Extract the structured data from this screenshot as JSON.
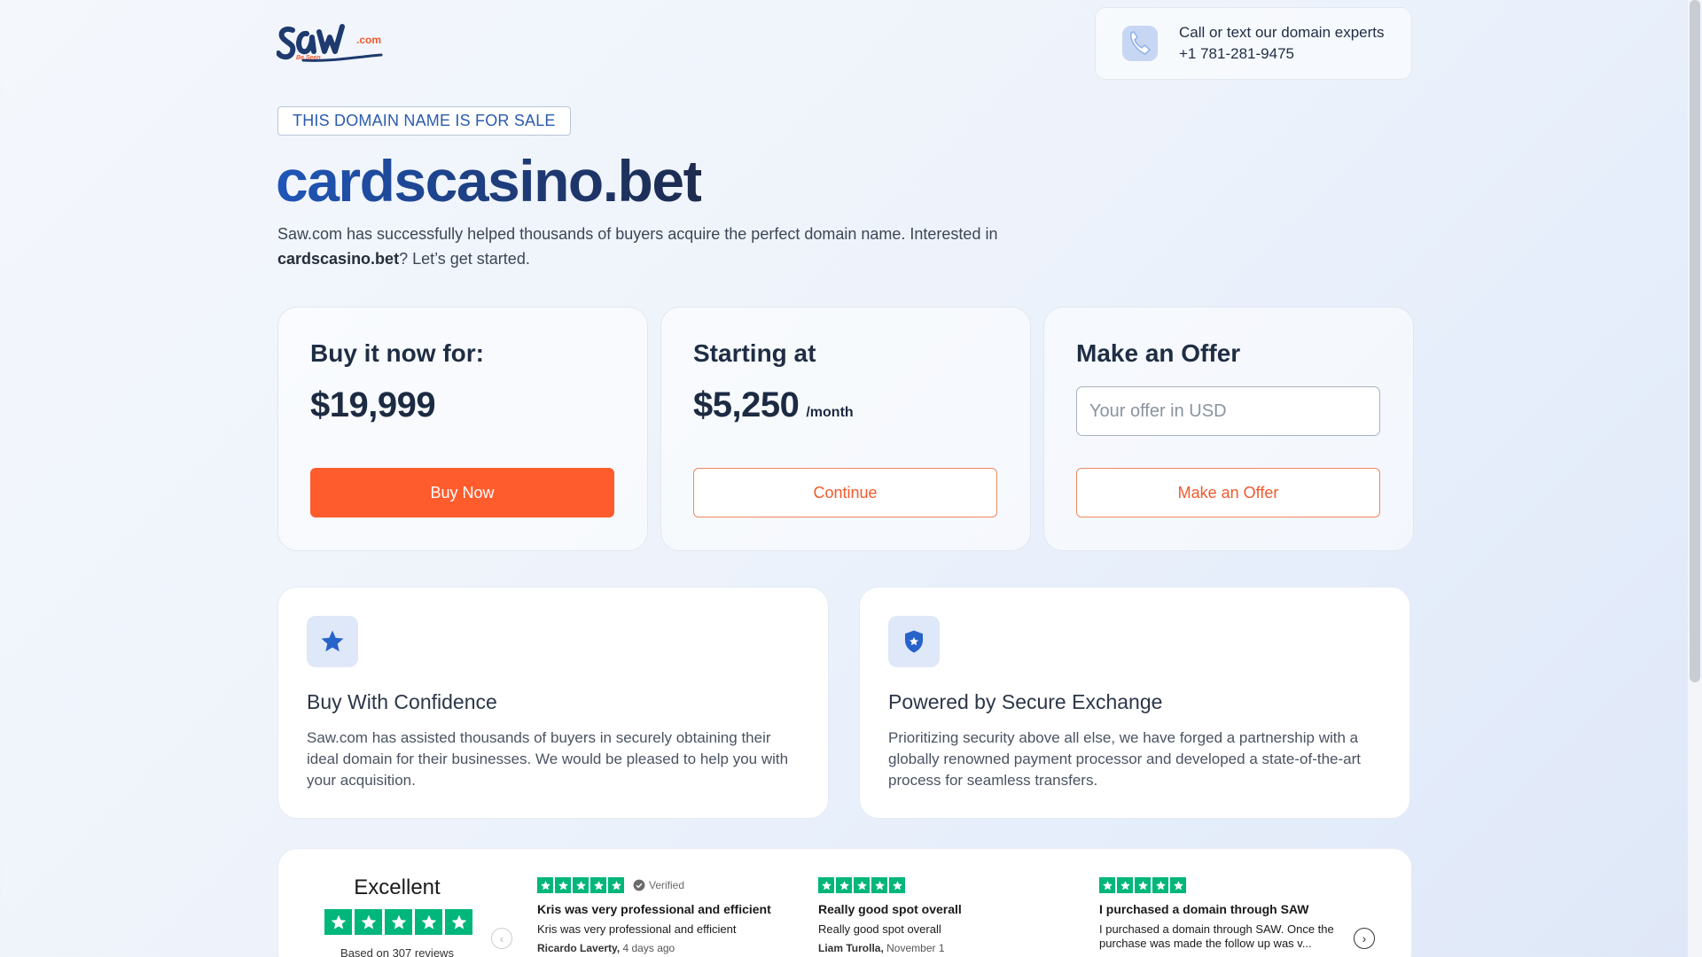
{
  "header": {
    "logo_text": "saw.com",
    "logo_tagline": "Be Seen",
    "contact_line1": "Call or text our domain experts",
    "contact_phone": "+1 781-281-9475"
  },
  "hero": {
    "badge": "THIS DOMAIN NAME IS FOR SALE",
    "domain": "cardscasino.bet",
    "intro_part1": "Saw.com has successfully helped thousands of buyers acquire the perfect domain name. Interested in ",
    "intro_domain": "cardscasino.bet",
    "intro_part2": "? Let’s get started."
  },
  "pricing": {
    "buy": {
      "title": "Buy it now for:",
      "price": "$19,999",
      "button": "Buy Now"
    },
    "lease": {
      "title": "Starting at",
      "price": "$5,250",
      "period": "/month",
      "button": "Continue"
    },
    "offer": {
      "title": "Make an Offer",
      "placeholder": "Your offer in USD",
      "button": "Make an Offer"
    }
  },
  "features": [
    {
      "icon": "star-icon",
      "title": "Buy With Confidence",
      "text": "Saw.com has assisted thousands of buyers in securely obtaining their ideal domain for their businesses. We would be pleased to help you with your acquisition."
    },
    {
      "icon": "shield-icon",
      "title": "Powered by Secure Exchange",
      "text": "Prioritizing security above all else, we have forged a partnership with a globally renowned payment processor and developed a state-of-the-art process for seamless transfers."
    }
  ],
  "trustpilot": {
    "rating_word": "Excellent",
    "based_on": "Based on 307 reviews",
    "star_color": "#00b67a",
    "reviews": [
      {
        "verified": "Verified",
        "title": "Kris was very professional and efficient",
        "body": "Kris was very professional and efficient",
        "author": "Ricardo Laverty,",
        "date": "4 days ago"
      },
      {
        "verified": "",
        "title": "Really good spot overall",
        "body": "Really good spot overall",
        "author": "Liam Turolla,",
        "date": "November 1"
      },
      {
        "verified": "",
        "title": "I purchased a domain through SAW",
        "body": "I purchased a domain through SAW. Once the purchase was made the follow up was v...",
        "author": "",
        "date": ""
      }
    ]
  },
  "colors": {
    "accent": "#fe5c2c",
    "brand_blue": "#1f56b9"
  }
}
